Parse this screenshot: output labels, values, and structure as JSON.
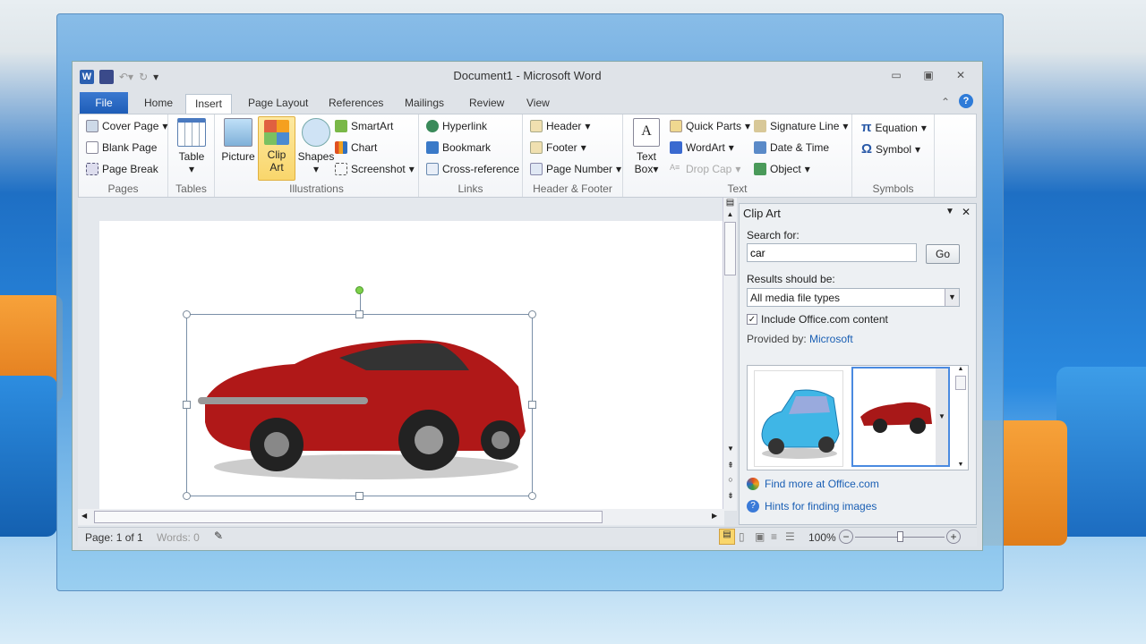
{
  "window": {
    "title": "Document1 - Microsoft Word",
    "app_icon": "word-icon",
    "controls": [
      "minimize",
      "maximize",
      "close"
    ]
  },
  "qat": {
    "icons": [
      "save-icon",
      "undo-icon",
      "redo-icon",
      "customize-icon"
    ]
  },
  "tabs": [
    {
      "label": "File"
    },
    {
      "label": "Home"
    },
    {
      "label": "Insert",
      "active": true
    },
    {
      "label": "Page Layout"
    },
    {
      "label": "References"
    },
    {
      "label": "Mailings"
    },
    {
      "label": "Review"
    },
    {
      "label": "View"
    }
  ],
  "ribbon": {
    "pages": {
      "label": "Pages",
      "items": [
        "Cover Page",
        "Blank Page",
        "Page Break"
      ]
    },
    "tables": {
      "label": "Tables",
      "table": "Table"
    },
    "illustrations": {
      "label": "Illustrations",
      "picture": "Picture",
      "clipart_1": "Clip",
      "clipart_2": "Art",
      "shapes": "Shapes",
      "items": [
        "SmartArt",
        "Chart",
        "Screenshot"
      ]
    },
    "links": {
      "label": "Links",
      "items": [
        "Hyperlink",
        "Bookmark",
        "Cross-reference"
      ]
    },
    "header_footer": {
      "label": "Header & Footer",
      "items": [
        "Header",
        "Footer",
        "Page Number"
      ]
    },
    "text": {
      "label": "Text",
      "textbox_1": "Text",
      "textbox_2": "Box",
      "items": [
        "Quick Parts",
        "WordArt",
        "Drop Cap"
      ],
      "items2": [
        "Signature Line",
        "Date & Time",
        "Object"
      ]
    },
    "symbols": {
      "label": "Symbols",
      "items": [
        "Equation",
        "Symbol"
      ]
    }
  },
  "clipart": {
    "title": "Clip Art",
    "search_label": "Search for:",
    "search_value": "car",
    "go": "Go",
    "results_label": "Results should be:",
    "results_value": "All media file types",
    "include_label": "Include Office.com content",
    "include_checked": true,
    "provided_label": "Provided by:",
    "provider": "Microsoft",
    "results": [
      "blue-car-clip",
      "red-sports-car-clip"
    ],
    "find_more": "Find more at Office.com",
    "hints": "Hints for finding images"
  },
  "status": {
    "page": "Page: 1 of 1",
    "words": "Words: 0",
    "zoom": "100%",
    "zoom_level": 100
  },
  "colors": {
    "accent": "#1e5db8",
    "clip_selected": "#f9d66c"
  }
}
